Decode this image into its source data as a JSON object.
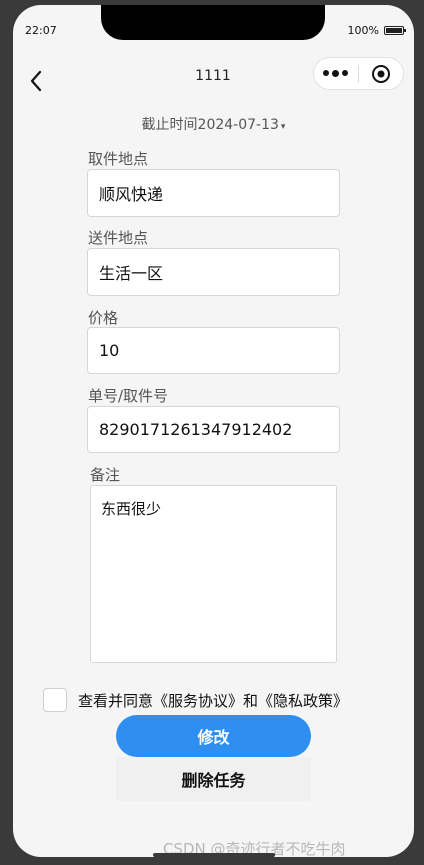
{
  "status": {
    "time": "22:07",
    "battery": "100%"
  },
  "nav": {
    "title": "1111"
  },
  "deadline": {
    "text": "截止时间2024-07-13",
    "caret": "▾"
  },
  "form": {
    "pickup_label": "取件地点",
    "pickup_value": "顺风快递",
    "delivery_label": "送件地点",
    "delivery_value": "生活一区",
    "price_label": "价格",
    "price_value": "10",
    "tracking_label": "单号/取件号",
    "tracking_value": "8290171261347912402",
    "notes_label": "备注",
    "notes_value": "东西很少"
  },
  "agreement": {
    "text": "查看并同意《服务协议》和《隐私政策》"
  },
  "buttons": {
    "modify": "修改",
    "delete": "删除任务"
  },
  "watermark": "CSDN @奇迹行者不吃牛肉"
}
